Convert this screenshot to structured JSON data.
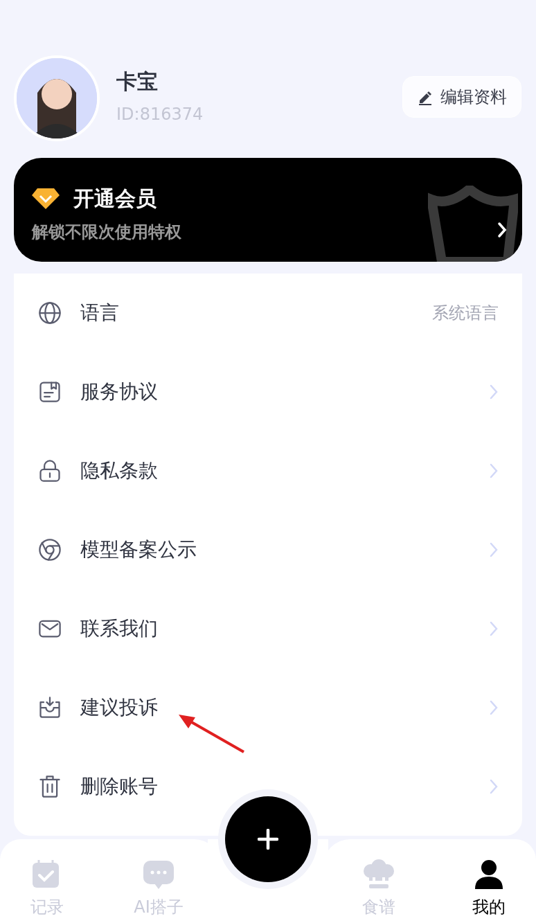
{
  "profile": {
    "name": "卡宝",
    "id": "ID:816374",
    "edit_button": "编辑资料"
  },
  "vip": {
    "title": "开通会员",
    "subtitle": "解锁不限次使用特权"
  },
  "menu": [
    {
      "kind": "value",
      "label": "语言",
      "value": "系统语言"
    },
    {
      "kind": "link",
      "label": "服务协议"
    },
    {
      "kind": "link",
      "label": "隐私条款"
    },
    {
      "kind": "link",
      "label": "模型备案公示"
    },
    {
      "kind": "link",
      "label": "联系我们"
    },
    {
      "kind": "link",
      "label": "建议投诉"
    },
    {
      "kind": "link",
      "label": "删除账号"
    }
  ],
  "tabs": [
    {
      "label": "记录",
      "selected": false
    },
    {
      "label": "AI搭子",
      "selected": false
    },
    {
      "label": "食谱",
      "selected": false
    },
    {
      "label": "我的",
      "selected": true
    }
  ]
}
